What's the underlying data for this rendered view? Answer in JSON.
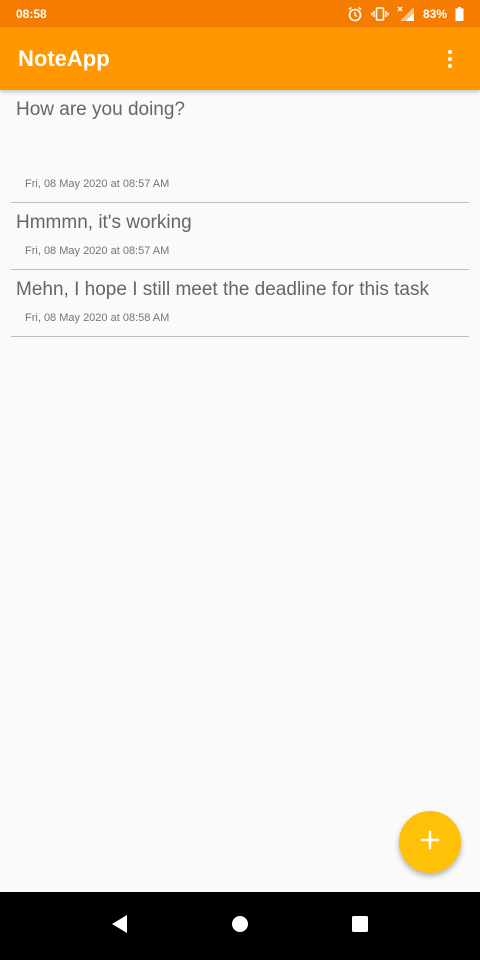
{
  "status_bar": {
    "time": "08:58",
    "battery": "83%",
    "icons": [
      "alarm-icon",
      "vibrate-icon",
      "signal-icon",
      "battery-icon"
    ]
  },
  "app_bar": {
    "title": "NoteApp",
    "menu_icon": "more-vert-icon"
  },
  "notes": [
    {
      "title": "How are you doing?",
      "date": "Fri, 08 May 2020 at 08:57 AM"
    },
    {
      "title": "Hmmmn, it's working",
      "date": "Fri, 08 May 2020 at 08:57 AM"
    },
    {
      "title": "Mehn, I hope I still meet the deadline for this task",
      "date": "Fri, 08 May 2020 at 08:58 AM"
    }
  ],
  "fab": {
    "icon": "add-icon"
  },
  "nav_bar": {
    "icons": [
      "back-icon",
      "home-icon",
      "recents-icon"
    ]
  },
  "colors": {
    "status_bar": "#f57c00",
    "app_bar": "#ff9800",
    "fab": "#ffc107",
    "background": "#fafafa"
  }
}
